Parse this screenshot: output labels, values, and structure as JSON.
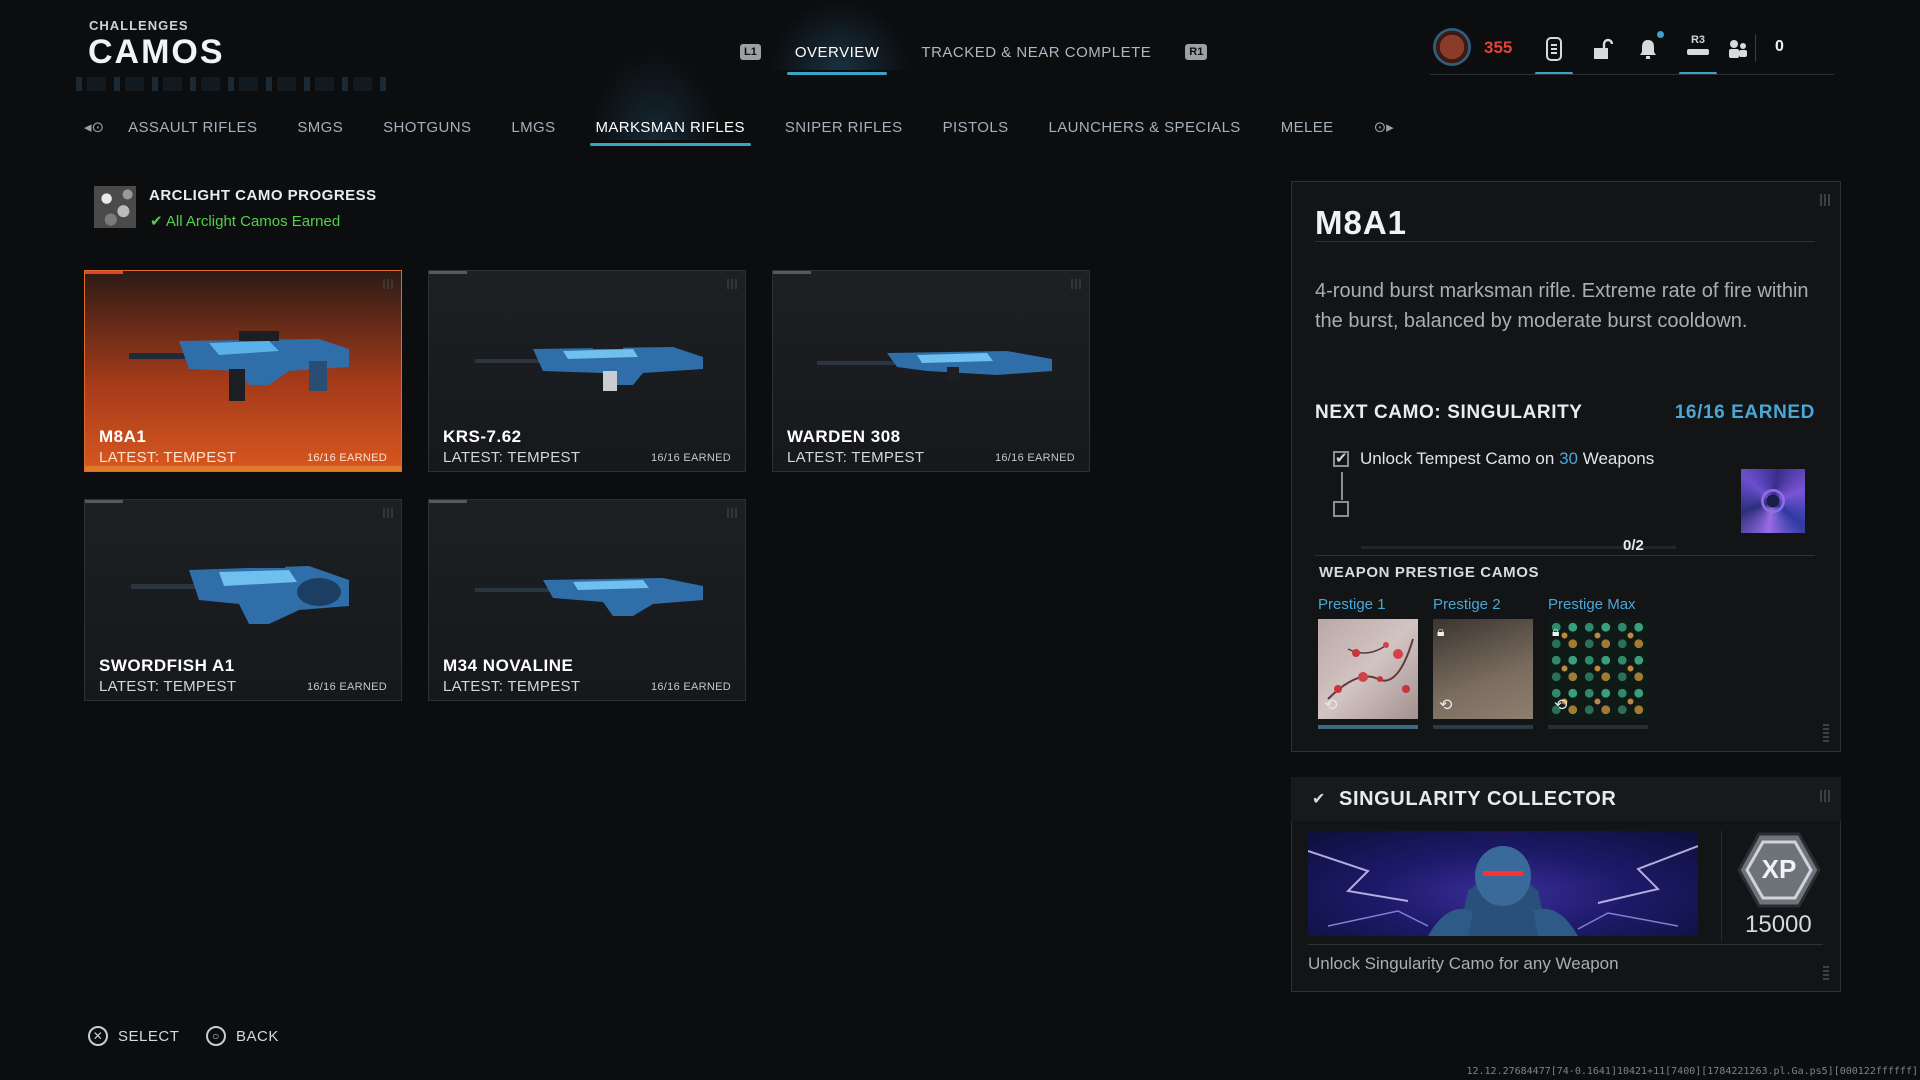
{
  "header": {
    "section": "CHALLENGES",
    "title": "CAMOS"
  },
  "top_tabs": {
    "left_bumper": "L1",
    "right_bumper": "R1",
    "items": [
      "OVERVIEW",
      "TRACKED & NEAR COMPLETE"
    ],
    "active": 0
  },
  "top_right": {
    "currency": "355",
    "r3_label": "R3",
    "party_count": "0"
  },
  "categories": {
    "items": [
      "ASSAULT RIFLES",
      "SMGS",
      "SHOTGUNS",
      "LMGS",
      "MARKSMAN RIFLES",
      "SNIPER RIFLES",
      "PISTOLS",
      "LAUNCHERS & SPECIALS",
      "MELEE"
    ],
    "active": 4
  },
  "arclight": {
    "title": "ARCLIGHT CAMO PROGRESS",
    "status": "All Arclight Camos Earned"
  },
  "weapons": [
    {
      "name": "M8A1",
      "latest": "LATEST: TEMPEST",
      "earned": "16/16 EARNED"
    },
    {
      "name": "KRS-7.62",
      "latest": "LATEST: TEMPEST",
      "earned": "16/16 EARNED"
    },
    {
      "name": "WARDEN 308",
      "latest": "LATEST: TEMPEST",
      "earned": "16/16 EARNED"
    },
    {
      "name": "SWORDFISH A1",
      "latest": "LATEST: TEMPEST",
      "earned": "16/16 EARNED"
    },
    {
      "name": "M34 NOVALINE",
      "latest": "LATEST: TEMPEST",
      "earned": "16/16 EARNED"
    }
  ],
  "detail": {
    "title": "M8A1",
    "description": "4-round burst marksman rifle. Extreme rate of fire within the burst, balanced by moderate burst cooldown.",
    "next_camo": "NEXT CAMO: SINGULARITY",
    "earned": "16/16 EARNED",
    "task_prefix": "Unlock Tempest Camo on",
    "task_count": "30",
    "task_suffix": "Weapons",
    "progress_text": "0/2",
    "prestige_header": "WEAPON PRESTIGE CAMOS",
    "prestige": [
      {
        "label": "Prestige 1",
        "locked": false
      },
      {
        "label": "Prestige 2",
        "locked": true
      },
      {
        "label": "Prestige Max",
        "locked": true
      }
    ]
  },
  "collector": {
    "title": "SINGULARITY COLLECTOR",
    "xp_label": "XP",
    "xp": "15000",
    "description": "Unlock Singularity Camo for any Weapon"
  },
  "footer": {
    "select": "SELECT",
    "back": "BACK",
    "build": "12.12.27684477[74-0.1641]10421+11[7400][1784221263.pl.Ga.ps5][000122ffffff]"
  },
  "colors": {
    "accent": "#3ba4c6",
    "highlight_blue": "#4aa7d6",
    "success_green": "#51d14a",
    "currency_red": "#e0433a",
    "selected_orange": "#d9571f"
  }
}
